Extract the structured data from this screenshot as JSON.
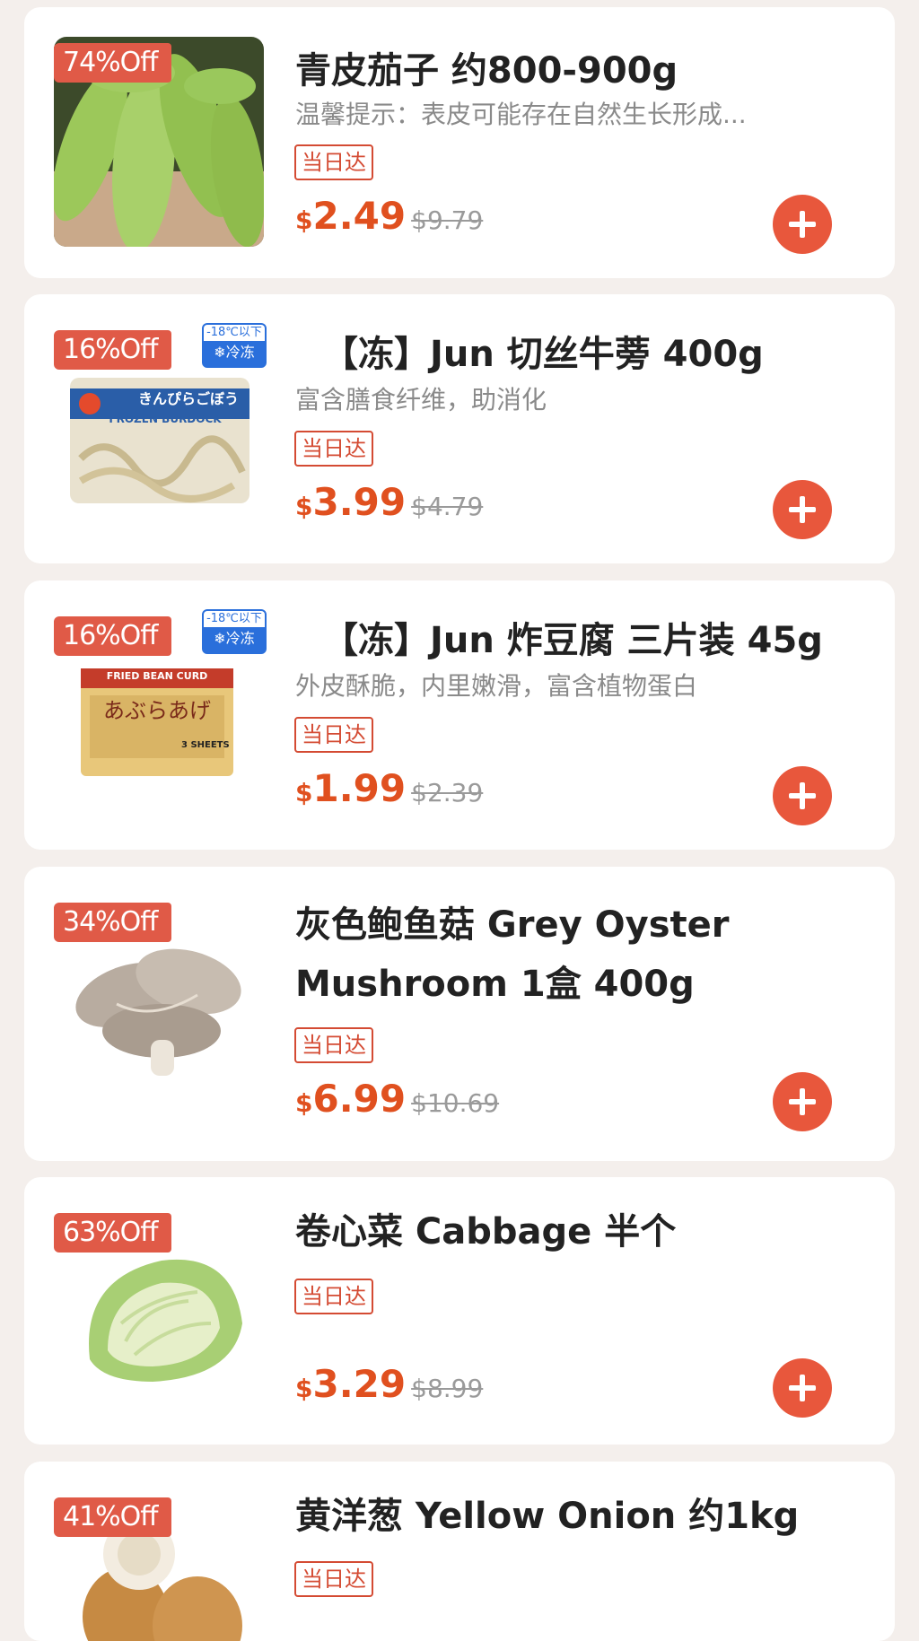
{
  "colors": {
    "accent": "#e05a47",
    "price": "#e0501f",
    "frozen": "#2a6fdb",
    "background": "#f4efec"
  },
  "products": [
    {
      "discount": "74%Off",
      "title": "青皮茄子 约800-900g",
      "desc": "温馨提示：表皮可能存在自然生长形成...",
      "tag": "当日达",
      "currency": "$",
      "price": "2.49",
      "old_price": "$9.79",
      "image_icon": "green-eggplant-image"
    },
    {
      "discount": "16%Off",
      "frozen_top": "-18℃以下",
      "frozen_bottom": "❄冷冻",
      "title": "【冻】Jun 切丝牛蒡 400g",
      "desc": "富含膳食纤维，助消化",
      "tag": "当日达",
      "currency": "$",
      "price": "3.99",
      "old_price": "$4.79",
      "package_brand": "きんぴらごぼう",
      "package_label": "FROZEN BURDOCK"
    },
    {
      "discount": "16%Off",
      "frozen_top": "-18℃以下",
      "frozen_bottom": "❄冷冻",
      "title": "【冻】Jun 炸豆腐 三片装 45g",
      "desc": "外皮酥脆，内里嫩滑，富含植物蛋白",
      "tag": "当日达",
      "currency": "$",
      "price": "1.99",
      "old_price": "$2.39",
      "package_label": "FRIED BEAN CURD",
      "package_brand": "あぶらあげ",
      "package_count": "3 SHEETS"
    },
    {
      "discount": "34%Off",
      "title": "灰色鲍鱼菇 Grey Oyster Mushroom 1盒 400g",
      "tag": "当日达",
      "currency": "$",
      "price": "6.99",
      "old_price": "$10.69"
    },
    {
      "discount": "63%Off",
      "title": "卷心菜 Cabbage 半个",
      "tag": "当日达",
      "currency": "$",
      "price": "3.29",
      "old_price": "$8.99"
    },
    {
      "discount": "41%Off",
      "title": "黄洋葱 Yellow Onion 约1kg",
      "tag": "当日达"
    }
  ]
}
